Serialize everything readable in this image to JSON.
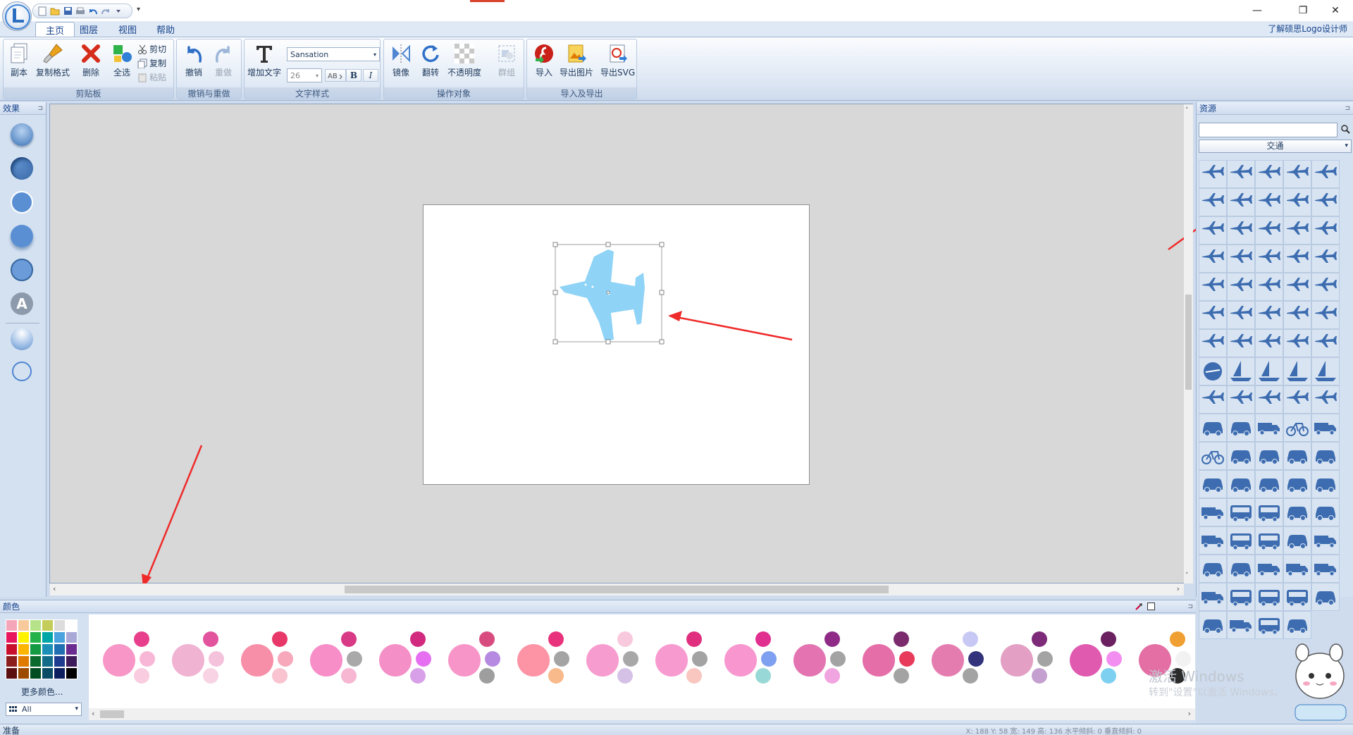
{
  "window": {
    "help_link": "了解硕思Logo设计师",
    "min": "—",
    "max": "❐",
    "close": "✕"
  },
  "tabs": [
    "主页",
    "图层",
    "视图",
    "帮助"
  ],
  "ribbon": {
    "clipboard": {
      "copy_page": "副本",
      "format_painter": "复制格式",
      "delete": "删除",
      "select_all": "全选",
      "cut": "剪切",
      "copy": "复制",
      "paste": "粘贴",
      "label": "剪贴板"
    },
    "undo": {
      "undo": "撤销",
      "redo": "重做",
      "label": "撤销与重做"
    },
    "text": {
      "add_text": "增加文字",
      "font": "Sansation",
      "size": "26",
      "bold": "B",
      "italic": "I",
      "label": "文字样式"
    },
    "object": {
      "mirror": "镜像",
      "flip": "翻转",
      "opacity": "不透明度",
      "group": "群组",
      "label": "操作对象"
    },
    "io": {
      "import": "导入",
      "export_image": "导出图片",
      "export_svg": "导出SVG",
      "label": "导入及导出"
    }
  },
  "left_pane": {
    "title": "效果",
    "pin": "ᵖ"
  },
  "right_pane": {
    "title": "资源",
    "search_placeholder": "",
    "category": "交通",
    "pin": "ᵖ"
  },
  "color_pane": {
    "title": "颜色",
    "more_colors": "更多颜色...",
    "filter": "All"
  },
  "status": {
    "text": "准备",
    "coords": "X: 188   Y: 58   宽: 149   高: 136   水平倾斜: 0   垂直倾斜: 0"
  },
  "watermark": {
    "line1": "激活 Windows",
    "line2": "转到\"设置\"以激活 Windows。"
  },
  "colors": {
    "accent": "#15428b",
    "plane": "#8fd3f7",
    "arrow": "#ef2a2a",
    "res_icon": "#3d6db0"
  },
  "swatches": [
    "#f4a6b8",
    "#f7c99b",
    "#b6e38a",
    "#c4cc5a",
    "#dcdcdc",
    "#ffffff",
    "#e8175d",
    "#fff200",
    "#26b24a",
    "#00a6a6",
    "#4aa3df",
    "#a9a9d8",
    "#c8102e",
    "#ffb400",
    "#139a43",
    "#1b8fb5",
    "#1f6fb2",
    "#6b2c91",
    "#8b1d1d",
    "#e07b00",
    "#0b6b2e",
    "#136b8a",
    "#1d3c8f",
    "#3d1b5a",
    "#5b0f0f",
    "#9c4a00",
    "#004d22",
    "#0a4c66",
    "#0c1f5e",
    "#000000"
  ],
  "schemes": [
    [
      "#f796c7",
      "#e83f8c",
      "#f8b7d6",
      "#f9cce0"
    ],
    [
      "#f0b3d2",
      "#e3549f",
      "#f5c2dc",
      "#f7d3e4"
    ],
    [
      "#f78fa8",
      "#e8386a",
      "#f7a8bb",
      "#f9c3d0"
    ],
    [
      "#f88ec8",
      "#d93a86",
      "#a9a9a9",
      "#f7b6d2"
    ],
    [
      "#f58fc7",
      "#d12a7e",
      "#e56ff0",
      "#d8a0e8"
    ],
    [
      "#f795c8",
      "#d84b7f",
      "#b58ae0",
      "#9e9e9e"
    ],
    [
      "#fc94a6",
      "#e8327c",
      "#a4a4a4",
      "#f8b98b"
    ],
    [
      "#f79ccf",
      "#f8c9dc",
      "#a8a8a8",
      "#d6c1e6"
    ],
    [
      "#f79ad0",
      "#df2f7e",
      "#a3a3a3",
      "#f9c6c0"
    ],
    [
      "#f897cf",
      "#e12f8f",
      "#7f9ff0",
      "#98d8d6"
    ],
    [
      "#e474b1",
      "#8f2b86",
      "#a3a3a3",
      "#f0a4e0"
    ],
    [
      "#e56da8",
      "#7b2a6d",
      "#e83a5a",
      "#a3a3a3"
    ],
    [
      "#e57caf",
      "#c8c8f5",
      "#32337a",
      "#a3a3a3"
    ],
    [
      "#e3a0c4",
      "#7d2a78",
      "#a3a3a3",
      "#c4a0d0"
    ],
    [
      "#e05ab0",
      "#6b2060",
      "#f28ef0",
      "#7dd0f0"
    ],
    [
      "#e36fa4",
      "#f0a033",
      "#f2f2f2",
      "#2b2b2b"
    ]
  ]
}
